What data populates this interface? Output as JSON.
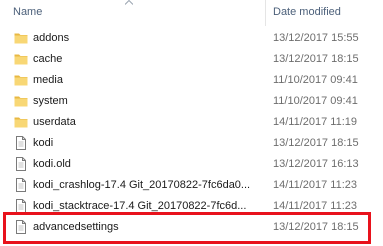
{
  "columns": {
    "name": "Name",
    "date": "Date modified"
  },
  "files": [
    {
      "name": "addons",
      "date": "13/12/2017 15:55",
      "type": "folder"
    },
    {
      "name": "cache",
      "date": "13/12/2017 18:15",
      "type": "folder"
    },
    {
      "name": "media",
      "date": "11/10/2017 09:41",
      "type": "folder"
    },
    {
      "name": "system",
      "date": "11/10/2017 09:41",
      "type": "folder"
    },
    {
      "name": "userdata",
      "date": "14/11/2017 11:19",
      "type": "folder"
    },
    {
      "name": "kodi",
      "date": "13/12/2017 18:15",
      "type": "file"
    },
    {
      "name": "kodi.old",
      "date": "13/12/2017 16:13",
      "type": "file"
    },
    {
      "name": "kodi_crashlog-17.4 Git_20170822-7fc6da0...",
      "date": "14/11/2017 11:23",
      "type": "file"
    },
    {
      "name": "kodi_stacktrace-17.4 Git_20170822-7fc6d...",
      "date": "14/11/2017 11:23",
      "type": "file"
    },
    {
      "name": "advancedsettings",
      "date": "13/12/2017 18:15",
      "type": "file"
    }
  ],
  "colors": {
    "folder": "#f8d775",
    "folder_dark": "#e8b843",
    "highlight": "#e8121c",
    "header_text": "#4c607a"
  }
}
